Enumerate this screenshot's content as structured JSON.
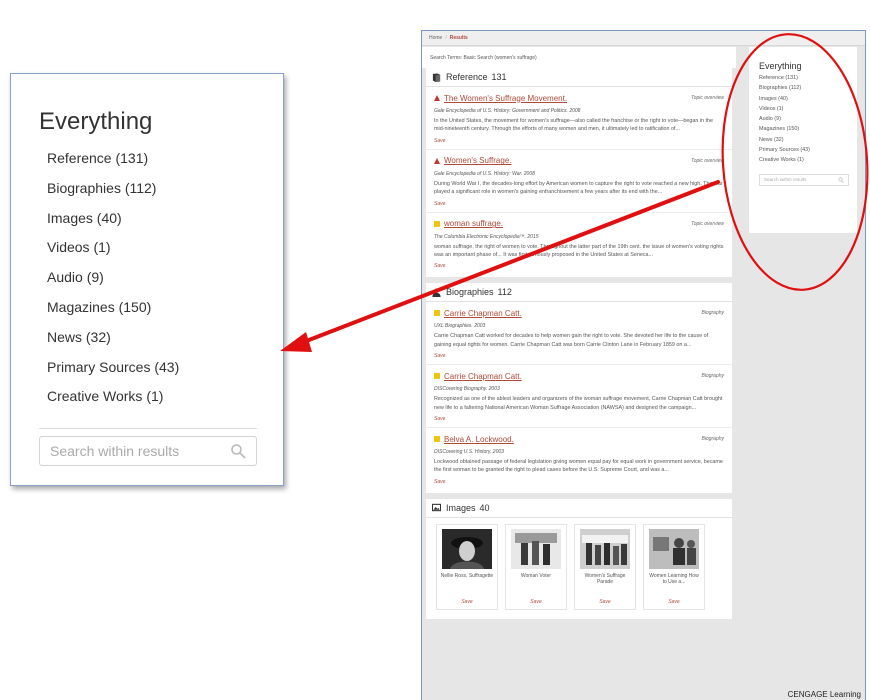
{
  "zoom": {
    "title": "Everything",
    "items": [
      "Reference (131)",
      "Biographies (112)",
      "Images (40)",
      "Videos (1)",
      "Audio (9)",
      "Magazines (150)",
      "News (32)",
      "Primary Sources (43)",
      "Creative Works (1)"
    ],
    "search_placeholder": "Search within results"
  },
  "breadcrumb": {
    "home": "Home",
    "sep": "/",
    "current": "Results"
  },
  "search_terms": "Search Terms: Basic Search (women's suffrage)",
  "sections": {
    "reference": {
      "label": "Reference",
      "count": "131",
      "results": [
        {
          "title": "The Women's Suffrage Movement.",
          "type": "Topic overview",
          "source": "Gale Encyclopedia of U.S. History: Government and Politics. 2008",
          "snippet": "In the United States, the movement for women's suffrage—also called the franchise or the right to vote—began in the mid-nineteenth century. Through the efforts of many women and men, it ultimately led to ratification of...",
          "save": "Save"
        },
        {
          "title": "Women's Suffrage.",
          "type": "Topic overview",
          "source": "Gale Encyclopedia of U.S. History: War. 2008",
          "snippet": "During World War I, the decades-long effort by American women to capture the right to vote reached a new high. The war played a significant role in women's gaining enfranchisement a few years after its end with the...",
          "save": "Save"
        },
        {
          "title": "woman suffrage.",
          "type": "Topic overview",
          "source": "The Columbia Electronic Encyclopedia™. 2015",
          "snippet": "woman suffrage, the right of women to vote. Throughout the latter part of the 19th cent. the issue of women's voting rights was an important phase of... It was first seriously proposed in the United States at Seneca...",
          "save": "Save"
        }
      ]
    },
    "biographies": {
      "label": "Biographies",
      "count": "112",
      "results": [
        {
          "title": "Carrie Chapman Catt.",
          "type": "Biography",
          "source": "UXL Biographies. 2003",
          "snippet": "Carrie Chapman Catt worked for decades to help women gain the right to vote. She devoted her life to the cause of gaining equal rights for women. Carrie Chapman Catt was born Carrie Clinton Lane in February 1859 on a...",
          "save": "Save"
        },
        {
          "title": "Carrie Chapman Catt.",
          "type": "Biography",
          "source": "DISCovering Biography. 2003",
          "snippet": "Recognized as one of the ablest leaders and organizers of the woman suffrage movement, Carrie Chapman Catt brought new life to a faltering National American Woman Suffrage Association (NAWSA) and designed the campaign...",
          "save": "Save"
        },
        {
          "title": "Belva A. Lockwood.",
          "type": "Biography",
          "source": "DISCovering U.S. History. 2003",
          "snippet": "Lockwood obtained passage of federal legislation giving women equal pay for equal work in government service, became the first woman to be granted the right to plead cases before the U.S. Supreme Court, and was a...",
          "save": "Save"
        }
      ]
    },
    "images": {
      "label": "Images",
      "count": "40",
      "items": [
        {
          "caption": "Nellie Ross, Suffragette",
          "save": "Save"
        },
        {
          "caption": "Woman Voter",
          "save": "Save"
        },
        {
          "caption": "Women's Suffrage Parade",
          "save": "Save"
        },
        {
          "caption": "Women Learning How to Use a...",
          "save": "Save"
        }
      ]
    }
  },
  "side": {
    "title": "Everything",
    "items": [
      "Reference (131)",
      "Biographies (112)",
      "Images (40)",
      "Videos (1)",
      "Audio (9)",
      "Magazines (150)",
      "News (32)",
      "Primary Sources (43)",
      "Creative Works (1)"
    ],
    "search_placeholder": "Search within results"
  },
  "footer_brand": "CENGAGE Learning",
  "colors": {
    "link": "#b04a3a",
    "annotation": "#e01010",
    "marker_reference": "#c0392b",
    "marker_other": "#f1c40f"
  }
}
